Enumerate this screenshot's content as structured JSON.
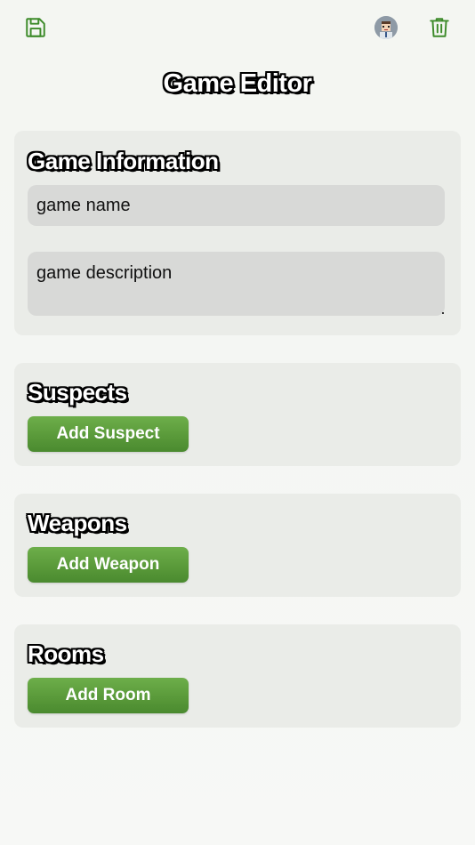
{
  "header": {
    "save_icon": "save-icon",
    "avatar_icon": "avatar",
    "trash_icon": "trash-icon",
    "icon_color": "#3d8b2a"
  },
  "page_title": "Game Editor",
  "game_info": {
    "title": "Game Information",
    "name_placeholder": "game name",
    "description_placeholder": "game description"
  },
  "suspects": {
    "title": "Suspects",
    "add_label": "Add Suspect"
  },
  "weapons": {
    "title": "Weapons",
    "add_label": "Add Weapon"
  },
  "rooms": {
    "title": "Rooms",
    "add_label": "Add Room"
  },
  "colors": {
    "button_green": "#5a9a3a",
    "card_background": "#eaece8",
    "field_background": "#d8d9d7"
  }
}
